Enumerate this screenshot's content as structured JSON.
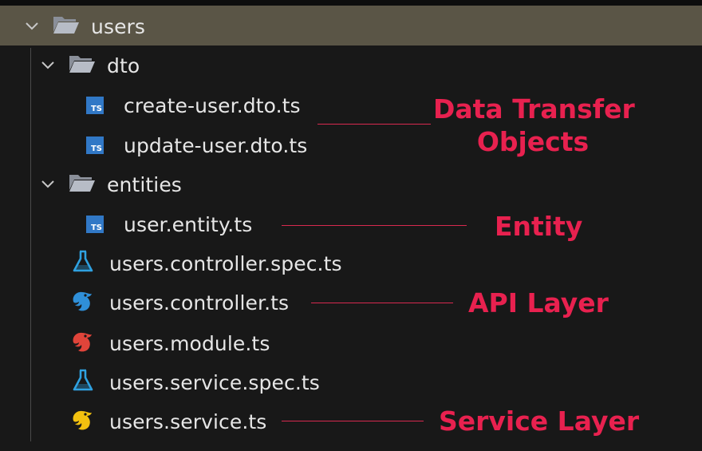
{
  "explorer": {
    "root": {
      "label": "users",
      "expanded": true
    },
    "items": [
      {
        "label": "dto",
        "kind": "folder",
        "expanded": true,
        "icon": "folder-open-icon"
      },
      {
        "label": "create-user.dto.ts",
        "kind": "file",
        "icon": "typescript-icon"
      },
      {
        "label": "update-user.dto.ts",
        "kind": "file",
        "icon": "typescript-icon"
      },
      {
        "label": "entities",
        "kind": "folder",
        "expanded": true,
        "icon": "folder-open-icon"
      },
      {
        "label": "user.entity.ts",
        "kind": "file",
        "icon": "typescript-icon"
      },
      {
        "label": "users.controller.spec.ts",
        "kind": "file",
        "icon": "test-flask-icon"
      },
      {
        "label": "users.controller.ts",
        "kind": "file",
        "icon": "nest-controller-icon"
      },
      {
        "label": "users.module.ts",
        "kind": "file",
        "icon": "nest-module-icon"
      },
      {
        "label": "users.service.spec.ts",
        "kind": "file",
        "icon": "test-flask-icon"
      },
      {
        "label": "users.service.ts",
        "kind": "file",
        "icon": "nest-service-icon"
      }
    ],
    "ts_badge": "TS"
  },
  "annotations": {
    "dto_line1": "Data Transfer",
    "dto_line2": "Objects",
    "entity": "Entity",
    "api": "API Layer",
    "service": "Service Layer"
  },
  "colors": {
    "annotation": "#e8214f",
    "typescript": "#3178c6",
    "test": "#2fa1e0",
    "nest_controller": "#2f8fd8",
    "nest_module": "#e0443a",
    "nest_service": "#f2c10f",
    "root_highlight": "#5a5546",
    "background": "#181818"
  }
}
